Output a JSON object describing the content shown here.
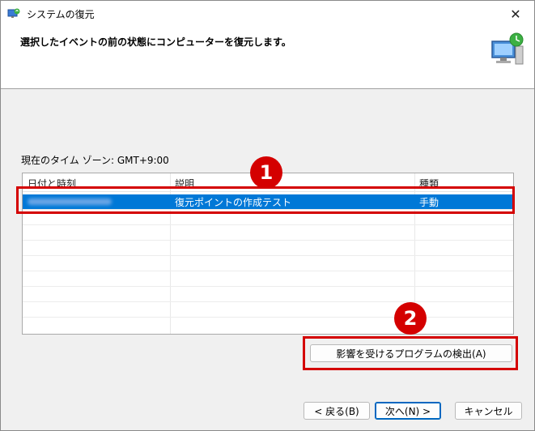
{
  "window": {
    "title": "システムの復元",
    "close_symbol": "✕"
  },
  "header": {
    "instruction": "選択したイベントの前の状態にコンピューターを復元します。",
    "icon": "system-restore-icon"
  },
  "timezone_label": "現在のタイム ゾーン: GMT+9:00",
  "table": {
    "columns": [
      "日付と時刻",
      "説明",
      "種類"
    ],
    "rows": [
      {
        "datetime": "",
        "description": "復元ポイントの作成テスト",
        "type": "手動",
        "selected": true
      }
    ]
  },
  "annotations": {
    "badge1": "1",
    "badge2": "2",
    "highlight_color": "#d40000"
  },
  "buttons": {
    "scan_programs": "影響を受けるプログラムの検出(A)",
    "back": "< 戻る(B)",
    "next": "次へ(N) >",
    "cancel": "キャンセル"
  },
  "colors": {
    "selection": "#0078d7",
    "dialog_bg": "#f0f0f0",
    "accent": "#0067c0"
  }
}
